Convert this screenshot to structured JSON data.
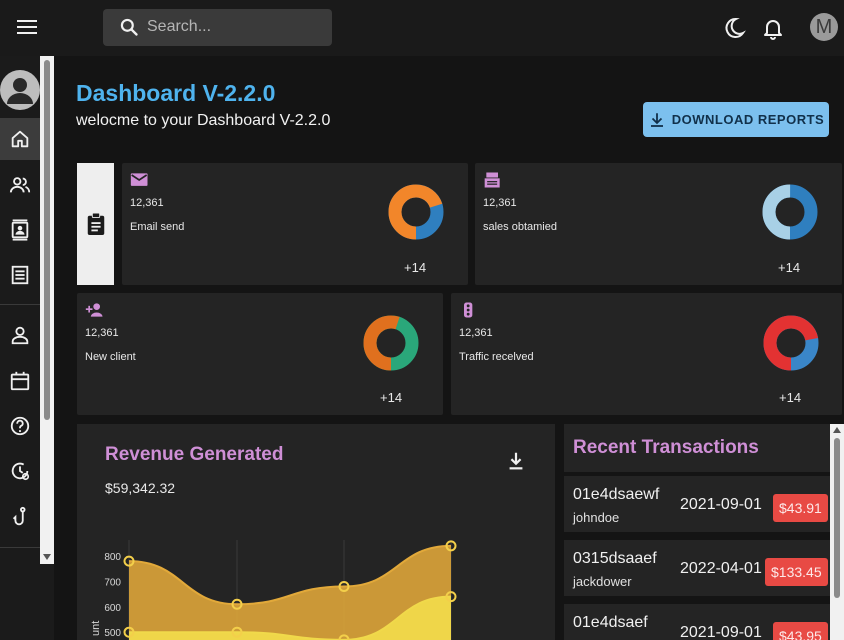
{
  "search": {
    "placeholder": "Search..."
  },
  "user": {
    "initial": "M"
  },
  "header": {
    "title": "Dashboard V-2.2.0",
    "subtitle": "welocme to your Dashboard V-2.2.0",
    "download_label": "DOWNLOAD REPORTS"
  },
  "stats": [
    {
      "icon": "email-icon",
      "value": "12,361",
      "label": "Email send",
      "increase": "+14",
      "progress": 0.7,
      "colors": [
        "#f2862a",
        "#2f7fbf"
      ]
    },
    {
      "icon": "point-of-sale-icon",
      "value": "12,361",
      "label": "sales obtamied",
      "increase": "+14",
      "progress": 0.5,
      "colors": [
        "#a8d0e6",
        "#2f7fbf"
      ]
    },
    {
      "icon": "person-add-icon",
      "value": "12,361",
      "label": "New client",
      "increase": "+14",
      "progress": 0.55,
      "colors": [
        "#e0701e",
        "#2aa77a"
      ]
    },
    {
      "icon": "traffic-icon",
      "value": "12,361",
      "label": "Traffic recelved",
      "increase": "+14",
      "progress": 0.72,
      "colors": [
        "#e33232",
        "#3a86c8"
      ]
    }
  ],
  "revenue": {
    "title": "Revenue Generated",
    "amount": "$59,342.32"
  },
  "transactions": {
    "title": "Recent Transactions",
    "rows": [
      {
        "id": "01e4dsaewf",
        "user": "johndoe",
        "date": "2021-09-01",
        "amount": "$43.91"
      },
      {
        "id": "0315dsaaef",
        "user": "jackdower",
        "date": "2022-04-01",
        "amount": "$133.45"
      },
      {
        "id": "01e4dsaef",
        "user": "",
        "date": "2021-09-01",
        "amount": "$43.95"
      }
    ]
  },
  "chart_data": {
    "type": "area",
    "ylabel": "unt",
    "y_ticks": [
      500,
      600,
      700,
      800
    ],
    "series": [
      {
        "values": [
          780,
          610,
          680,
          840
        ]
      },
      {
        "values": [
          500,
          500,
          470,
          640
        ]
      }
    ],
    "colors": [
      "#e2a93a",
      "#f0d94a"
    ]
  }
}
